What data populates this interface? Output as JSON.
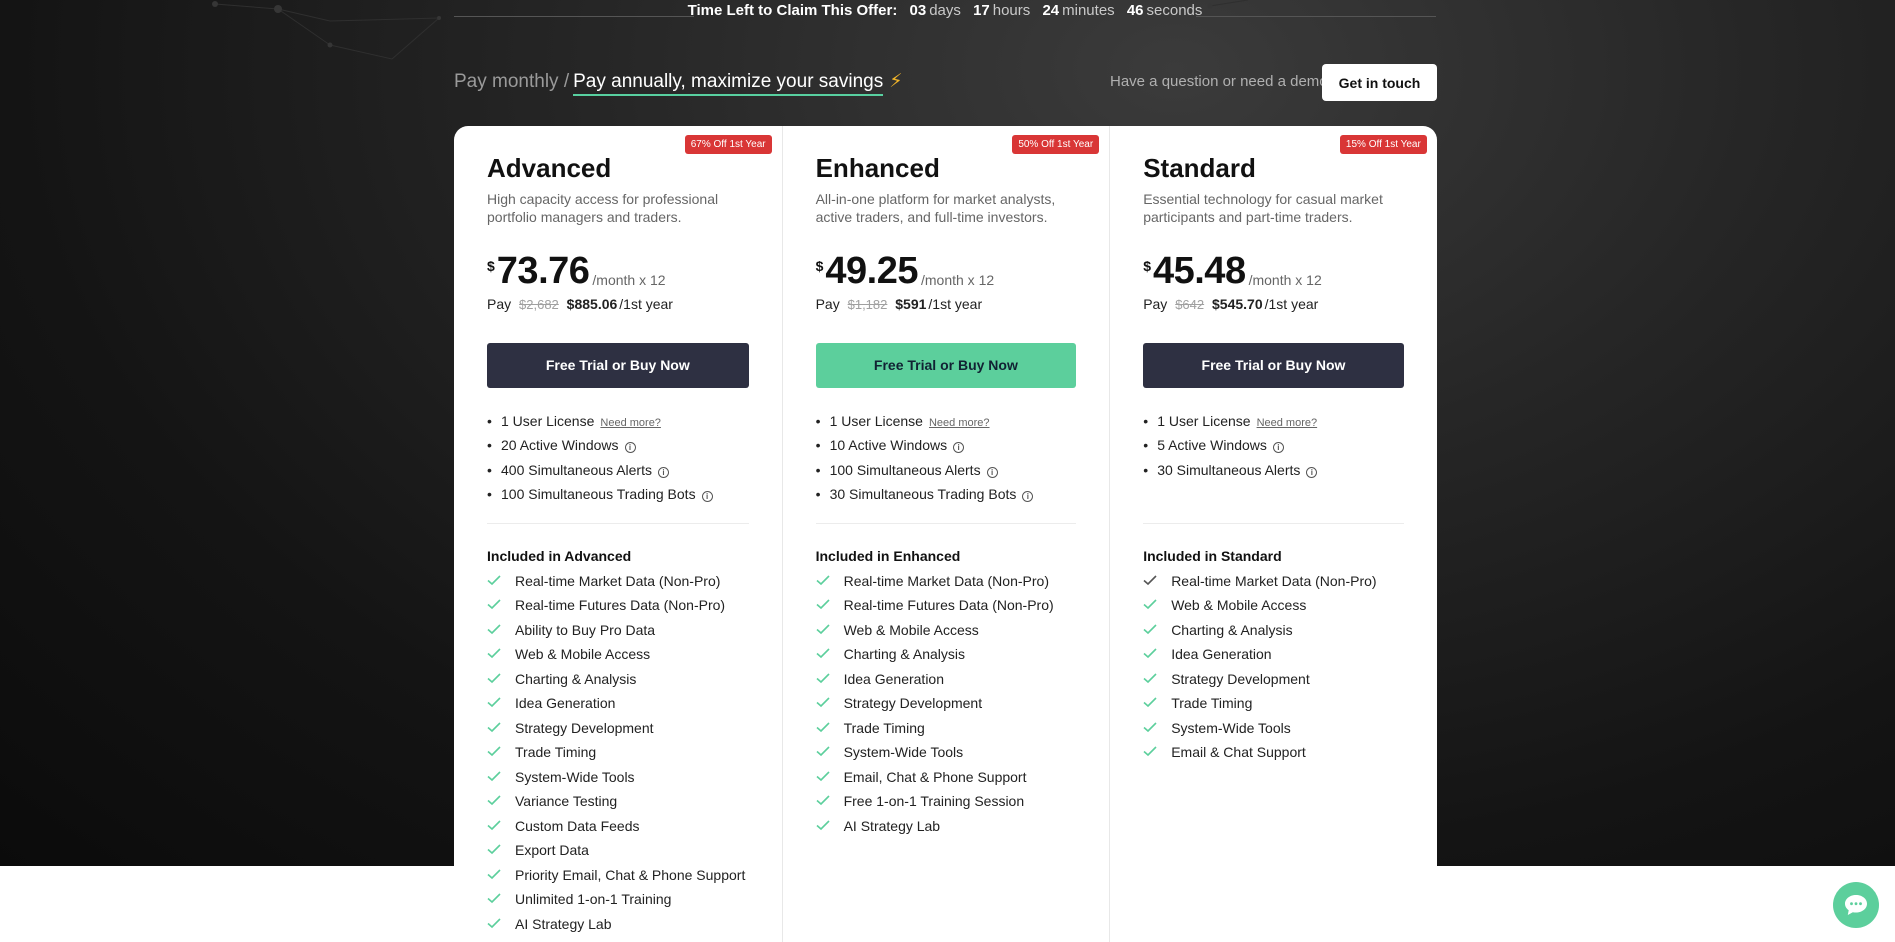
{
  "countdown": {
    "label": "Time Left to Claim This Offer:",
    "days": "03",
    "days_unit": "days",
    "hours": "17",
    "hours_unit": "hours",
    "minutes": "24",
    "minutes_unit": "minutes",
    "seconds": "46",
    "seconds_unit": "seconds"
  },
  "billing": {
    "monthly_label": "Pay monthly /",
    "annual_label": "Pay annually, maximize your savings"
  },
  "contact": {
    "question": "Have a question or need a demo?",
    "button_label": "Get in touch"
  },
  "common": {
    "pay_prefix": "Pay",
    "per_month": "/month x 12",
    "first_year": "/1st year",
    "currency": "$",
    "need_more": "Need more?",
    "cta_label": "Free Trial or Buy Now"
  },
  "plans": [
    {
      "name": "Advanced",
      "badge": "67% Off 1st Year",
      "description": "High capacity access for professional portfolio managers and traders.",
      "price": "73.76",
      "old_total": "$2,682",
      "new_total": "$885.06",
      "limits": [
        "1 User License",
        "20 Active Windows",
        "400 Simultaneous Alerts",
        "100 Simultaneous Trading Bots"
      ],
      "included_title": "Included in Advanced",
      "features": [
        "Real-time Market Data (Non-Pro)",
        "Real-time Futures Data (Non-Pro)",
        "Ability to Buy Pro Data",
        "Web & Mobile Access",
        "Charting & Analysis",
        "Idea Generation",
        "Strategy Development",
        "Trade Timing",
        "System-Wide Tools",
        "Variance Testing",
        "Custom Data Feeds",
        "Export Data",
        "Priority Email, Chat & Phone Support",
        "Unlimited 1-on-1 Training",
        "AI Strategy Lab"
      ]
    },
    {
      "name": "Enhanced",
      "badge": "50% Off 1st Year",
      "description": "All-in-one platform for market analysts, active traders, and full-time investors.",
      "price": "49.25",
      "old_total": "$1,182",
      "new_total": "$591",
      "limits": [
        "1 User License",
        "10 Active Windows",
        "100 Simultaneous Alerts",
        "30 Simultaneous Trading Bots"
      ],
      "included_title": "Included in Enhanced",
      "features": [
        "Real-time Market Data (Non-Pro)",
        "Real-time Futures Data (Non-Pro)",
        "Web & Mobile Access",
        "Charting & Analysis",
        "Idea Generation",
        "Strategy Development",
        "Trade Timing",
        "System-Wide Tools",
        "Email, Chat & Phone Support",
        "Free 1-on-1 Training Session",
        "AI Strategy Lab"
      ]
    },
    {
      "name": "Standard",
      "badge": "15% Off 1st Year",
      "description": "Essential technology for casual market participants and part-time traders.",
      "price": "45.48",
      "old_total": "$642",
      "new_total": "$545.70",
      "limits": [
        "1 User License",
        "5 Active Windows",
        "30 Simultaneous Alerts"
      ],
      "included_title": "Included in Standard",
      "features": [
        "Real-time Market Data (Non-Pro)",
        "Web & Mobile Access",
        "Charting & Analysis",
        "Idea Generation",
        "Strategy Development",
        "Trade Timing",
        "System-Wide Tools",
        "Email & Chat Support"
      ]
    }
  ],
  "colors": {
    "accent_green": "#5ccf9c",
    "dark_button": "#2e3042",
    "badge_red": "#d93636"
  }
}
